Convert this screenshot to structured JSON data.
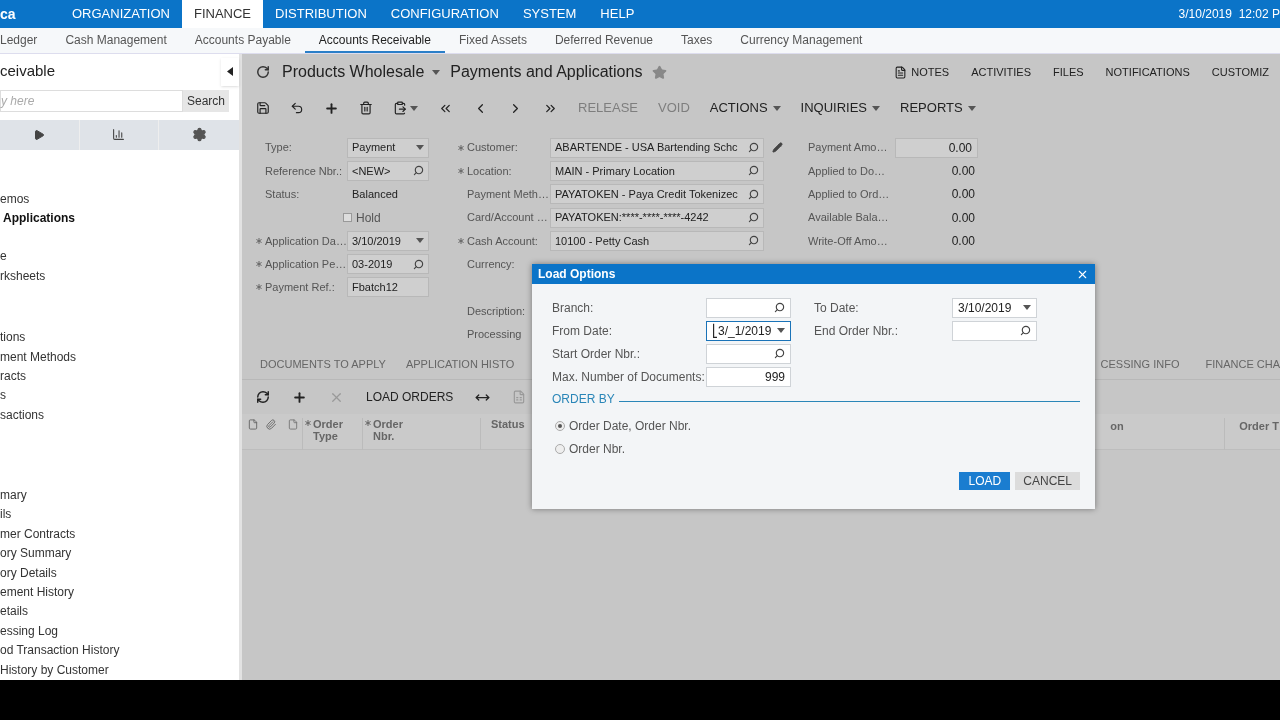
{
  "top_bar": {
    "logo": "ca",
    "menu": [
      {
        "label": "ORGANIZATION",
        "selected": false
      },
      {
        "label": "FINANCE",
        "selected": true
      },
      {
        "label": "DISTRIBUTION",
        "selected": false
      },
      {
        "label": "CONFIGURATION",
        "selected": false
      },
      {
        "label": "SYSTEM",
        "selected": false
      },
      {
        "label": "HELP",
        "selected": false
      }
    ],
    "datetime": "3/10/2019  12:02 P"
  },
  "sub_nav": [
    {
      "label": "Ledger",
      "selected": false
    },
    {
      "label": "Cash Management",
      "selected": false
    },
    {
      "label": "Accounts Payable",
      "selected": false
    },
    {
      "label": "Accounts Receivable",
      "selected": true
    },
    {
      "label": "Fixed Assets",
      "selected": false
    },
    {
      "label": "Deferred Revenue",
      "selected": false
    },
    {
      "label": "Taxes",
      "selected": false
    },
    {
      "label": "Currency Management",
      "selected": false
    }
  ],
  "sidebar": {
    "title": "ceivable",
    "search": {
      "placeholder": "y here",
      "button": "Search"
    },
    "sections": [
      {
        "items": [
          {
            "label": "emos",
            "selected": false
          },
          {
            "label": "Applications",
            "selected": true
          }
        ]
      },
      {
        "items": [
          {
            "label": "e",
            "selected": false
          },
          {
            "label": "rksheets",
            "selected": false
          }
        ]
      },
      {
        "items": [
          {
            "label": "tions",
            "selected": false
          },
          {
            "label": "ment Methods",
            "selected": false
          },
          {
            "label": "racts",
            "selected": false
          },
          {
            "label": "s",
            "selected": false
          },
          {
            "label": "sactions",
            "selected": false
          }
        ]
      },
      {
        "items": [
          {
            "label": "mary",
            "selected": false
          },
          {
            "label": "ils",
            "selected": false
          },
          {
            "label": "mer Contracts",
            "selected": false
          },
          {
            "label": "ory Summary",
            "selected": false
          },
          {
            "label": "ory Details",
            "selected": false
          },
          {
            "label": "ement History",
            "selected": false
          },
          {
            "label": "etails",
            "selected": false
          },
          {
            "label": "essing Log",
            "selected": false
          },
          {
            "label": "od Transaction History",
            "selected": false
          },
          {
            "label": "History by Customer",
            "selected": false
          }
        ]
      }
    ]
  },
  "header": {
    "company": "Products Wholesale",
    "title": "Payments and Applications",
    "links": [
      "NOTES",
      "ACTIVITIES",
      "FILES",
      "NOTIFICATIONS",
      "CUSTOMIZ"
    ]
  },
  "toolbar": {
    "text_buttons": [
      {
        "label": "RELEASE",
        "disabled": true
      },
      {
        "label": "VOID",
        "disabled": true
      }
    ],
    "menus": [
      "ACTIONS",
      "INQUIRIES",
      "REPORTS"
    ]
  },
  "form": {
    "column_1": [
      {
        "kind": "select",
        "label": "Type:",
        "required": false,
        "value": "Payment"
      },
      {
        "kind": "lookup",
        "label": "Reference Nbr.:",
        "required": false,
        "value": "<NEW>"
      },
      {
        "kind": "static",
        "label": "Status:",
        "required": false,
        "value": "Balanced"
      },
      {
        "kind": "checkbox",
        "label": "Hold",
        "checked": false
      },
      {
        "kind": "select",
        "label": "Application Da…",
        "required": true,
        "value": "3/10/2019"
      },
      {
        "kind": "lookup",
        "label": "Application Pe…",
        "required": true,
        "value": "03-2019"
      },
      {
        "kind": "text",
        "label": "Payment Ref.:",
        "required": true,
        "value": "Fbatch12"
      }
    ],
    "column_2": [
      {
        "kind": "lookup",
        "label": "Customer:",
        "required": true,
        "value": "ABARTENDE - USA Bartending Schc"
      },
      {
        "kind": "lookup",
        "label": "Location:",
        "required": true,
        "value": "MAIN - Primary Location"
      },
      {
        "kind": "lookup",
        "label": "Payment Meth…",
        "required": false,
        "value": "PAYATOKEN - Paya Credit Tokenizec"
      },
      {
        "kind": "lookup",
        "label": "Card/Account …",
        "required": false,
        "value": "PAYATOKEN:****-****-****-4242"
      },
      {
        "kind": "lookup",
        "label": "Cash Account:",
        "required": true,
        "value": "10100 - Petty Cash"
      },
      {
        "kind": "label",
        "label": "Currency:",
        "required": false
      },
      {
        "kind": "label",
        "label": "Description:",
        "required": false
      },
      {
        "kind": "label",
        "label": "Processing",
        "required": false
      }
    ],
    "column_3": [
      {
        "kind": "text",
        "label": "Payment Amo…",
        "value": "0.00"
      },
      {
        "kind": "static",
        "label": "Applied to Do…",
        "value": "0.00"
      },
      {
        "kind": "static",
        "label": "Applied to Ord…",
        "value": "0.00"
      },
      {
        "kind": "static",
        "label": "Available Bala…",
        "value": "0.00"
      },
      {
        "kind": "static",
        "label": "Write-Off Amo…",
        "value": "0.00"
      }
    ]
  },
  "tabs_left": [
    {
      "label": "DOCUMENTS TO APPLY",
      "selected": false
    },
    {
      "label": "APPLICATION HISTO",
      "selected": false
    }
  ],
  "tabs_right": [
    {
      "label": "CESSING INFO",
      "selected": false
    },
    {
      "label": "FINANCE CHA",
      "selected": false
    }
  ],
  "grid": {
    "toolbar_button": "LOAD ORDERS",
    "columns_left": [
      {
        "label": "Order Type",
        "required": true
      },
      {
        "label": "Order Nbr.",
        "required": true
      },
      {
        "label": "Status",
        "required": false
      }
    ],
    "columns_right": [
      "on",
      "Order T"
    ]
  },
  "dialog": {
    "title": "Load Options",
    "left_fields": [
      {
        "kind": "lookup",
        "label": "Branch:",
        "focused": false
      },
      {
        "kind": "select",
        "label": "From Date:",
        "value": "⎣3/_1/2019",
        "focused": true
      },
      {
        "kind": "lookup",
        "label": "Start Order Nbr.:",
        "focused": false
      },
      {
        "kind": "number",
        "label": "Max. Number of Documents:",
        "value": "999",
        "focused": false
      }
    ],
    "right_fields": [
      {
        "kind": "select",
        "label": "To Date:",
        "value": "3/10/2019",
        "focused": false
      },
      {
        "kind": "lookup",
        "label": "End Order Nbr.:",
        "focused": false
      }
    ],
    "order_by": {
      "heading": "ORDER BY",
      "options": [
        {
          "label": "Order Date, Order Nbr.",
          "selected": true
        },
        {
          "label": "Order Nbr.",
          "selected": false
        }
      ]
    },
    "buttons": [
      {
        "label": "LOAD",
        "kind": "primary"
      },
      {
        "label": "CANCEL",
        "kind": "secondary"
      }
    ]
  }
}
